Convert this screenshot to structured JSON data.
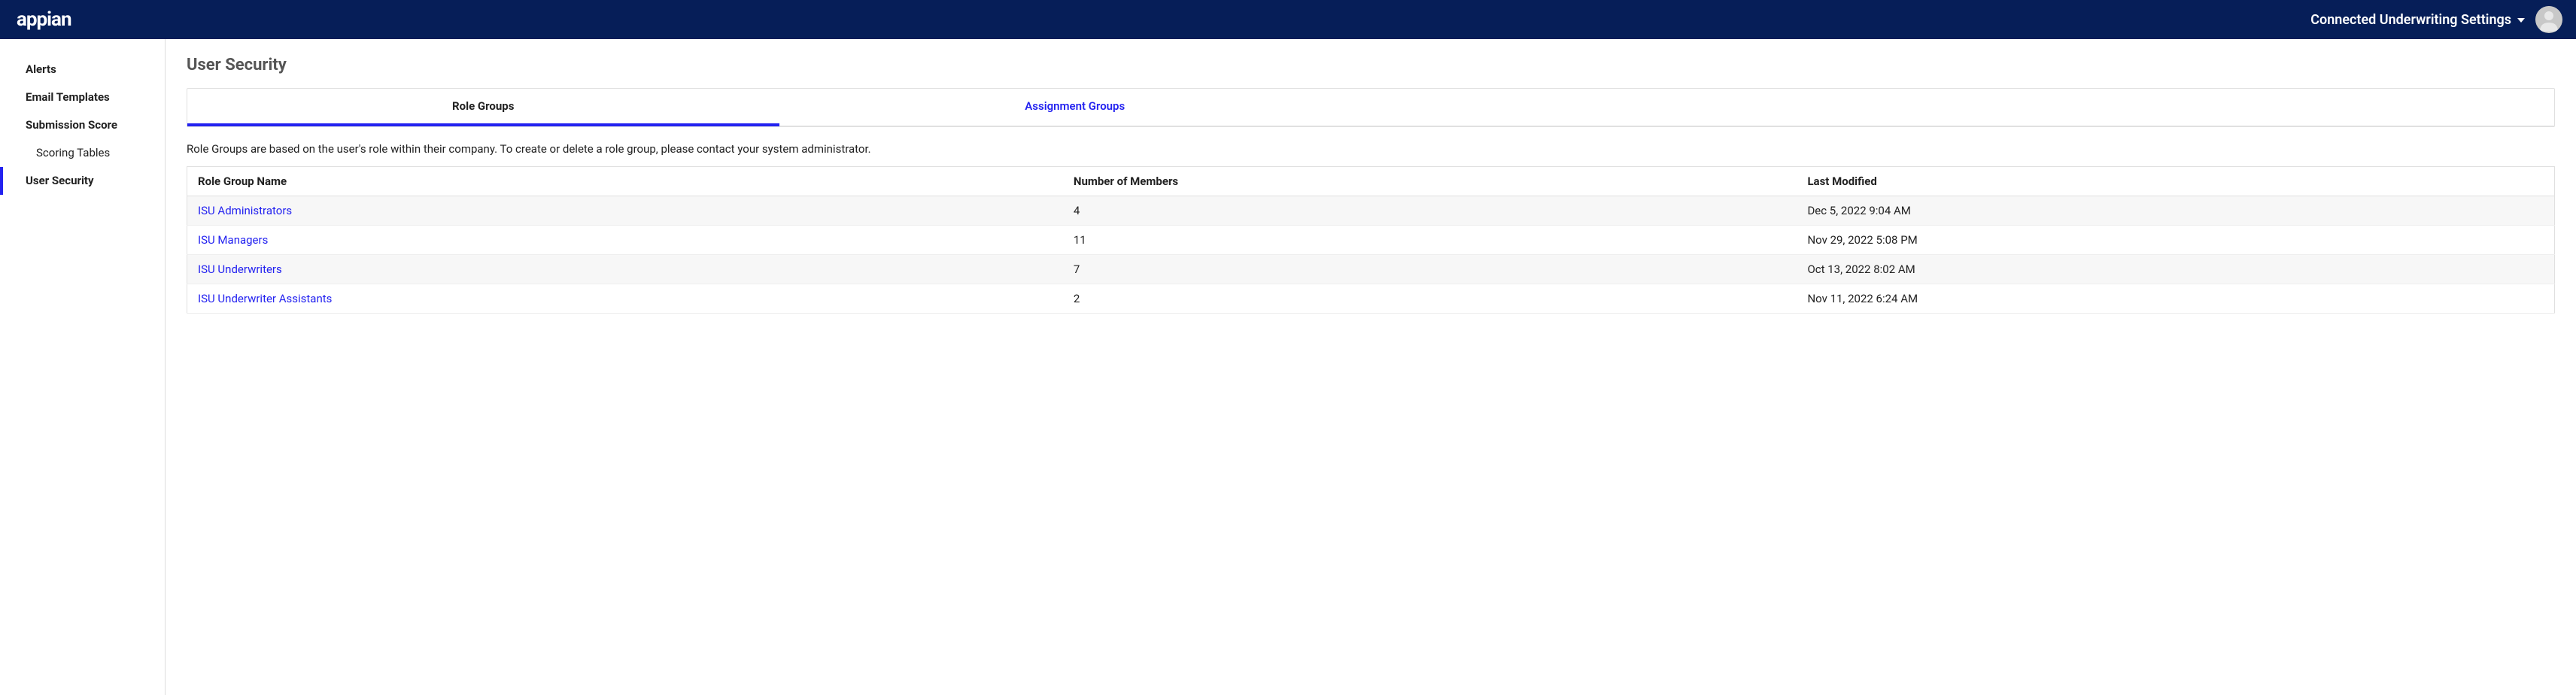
{
  "header": {
    "logo": "appian",
    "dropdown_label": "Connected Underwriting Settings"
  },
  "sidebar": {
    "items": [
      {
        "label": "Alerts",
        "active": false,
        "sub": false
      },
      {
        "label": "Email Templates",
        "active": false,
        "sub": false
      },
      {
        "label": "Submission Score",
        "active": false,
        "sub": false
      },
      {
        "label": "Scoring Tables",
        "active": false,
        "sub": true
      },
      {
        "label": "User Security",
        "active": true,
        "sub": false
      }
    ]
  },
  "page": {
    "title": "User Security",
    "tabs": [
      {
        "label": "Role Groups",
        "active": true
      },
      {
        "label": "Assignment Groups",
        "active": false
      }
    ],
    "description": "Role Groups are based on the user's role within their company. To create or delete a role group, please contact your system administrator.",
    "table": {
      "headers": [
        "Role Group Name",
        "Number of Members",
        "Last Modified"
      ],
      "rows": [
        {
          "name": "ISU Administrators",
          "members": "4",
          "modified": "Dec 5, 2022 9:04 AM"
        },
        {
          "name": "ISU Managers",
          "members": "11",
          "modified": "Nov 29, 2022 5:08 PM"
        },
        {
          "name": "ISU Underwriters",
          "members": "7",
          "modified": "Oct 13, 2022 8:02 AM"
        },
        {
          "name": "ISU Underwriter Assistants",
          "members": "2",
          "modified": "Nov 11, 2022 6:24 AM"
        }
      ]
    }
  }
}
